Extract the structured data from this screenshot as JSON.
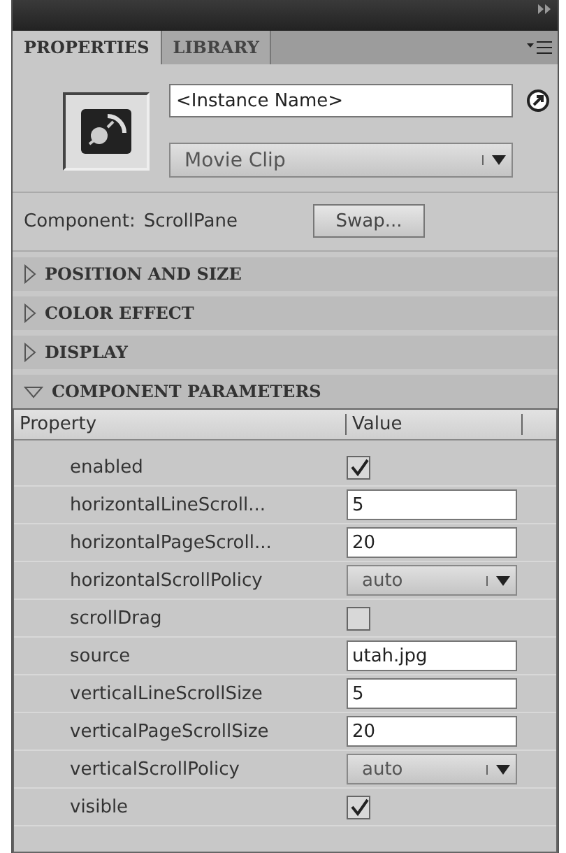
{
  "tabs": [
    {
      "label": "PROPERTIES",
      "selected": true
    },
    {
      "label": "LIBRARY",
      "selected": false
    }
  ],
  "instance": {
    "placeholder": "<Instance Name>",
    "type": "Movie Clip",
    "component_label": "Component:",
    "component": "ScrollPane",
    "swap": "Swap..."
  },
  "sections": [
    {
      "label": "POSITION AND SIZE",
      "expanded": false
    },
    {
      "label": "COLOR EFFECT",
      "expanded": false
    },
    {
      "label": "DISPLAY",
      "expanded": false
    },
    {
      "label": "COMPONENT PARAMETERS",
      "expanded": true
    }
  ],
  "table": {
    "columns": [
      "Property",
      "Value"
    ],
    "rows": [
      {
        "name": "enabled",
        "kind": "checkbox",
        "checked": true
      },
      {
        "name": "horizontalLineScroll...",
        "kind": "text",
        "value": "5"
      },
      {
        "name": "horizontalPageScroll...",
        "kind": "text",
        "value": "20"
      },
      {
        "name": "horizontalScrollPolicy",
        "kind": "dropdown",
        "value": "auto"
      },
      {
        "name": "scrollDrag",
        "kind": "checkbox",
        "checked": false
      },
      {
        "name": "source",
        "kind": "text",
        "value": "utah.jpg"
      },
      {
        "name": "verticalLineScrollSize",
        "kind": "text",
        "value": "5"
      },
      {
        "name": "verticalPageScrollSize",
        "kind": "text",
        "value": "20"
      },
      {
        "name": "verticalScrollPolicy",
        "kind": "dropdown",
        "value": "auto"
      },
      {
        "name": "visible",
        "kind": "checkbox",
        "checked": true
      }
    ]
  }
}
